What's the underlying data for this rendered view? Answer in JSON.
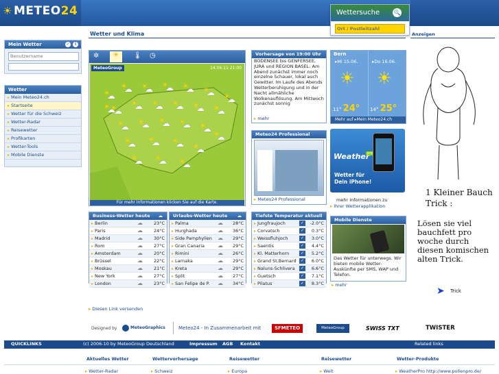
{
  "header": {
    "logo_text": "METEO",
    "logo_num": "24",
    "search_title": "Wettersuche",
    "search_placeholder": "Ort / Postleitzahl"
  },
  "main": {
    "title": "Wetter und Klima",
    "ads_label": "Anzeigen"
  },
  "left": {
    "mein_wetter": {
      "title": "Mein Wetter",
      "username_placeholder": "Benutzername"
    },
    "wetter": {
      "title": "Wetter",
      "items": [
        "Mein Meteo24.ch",
        "Startseite",
        "Wetter für die Schweiz",
        "Wetter-Radar",
        "Reisewetter",
        "Profikarten",
        "Wetter-Tools",
        "Mobile Dienste"
      ]
    }
  },
  "map": {
    "timestamp": "14.06.11 21:00",
    "brand": "MeteoGroup",
    "caption": "Für mehr Informationen klicken Sie auf die Karte."
  },
  "forecast": {
    "title": "Vorhersage von 19:00 Uhr",
    "text": "BODENSEE bis GENFERSEE, JURA und REGION BASEL: Am Abend zunächst immer noch einzelne Schauer, lokal auch Gewitter. Im Laufe des Abends Wetterberuhigung und in der Nacht allmähliche Wolkenauflösung. Am Mittwoch zunächst sonnig",
    "more": "mehr"
  },
  "bern": {
    "city": "Bern",
    "d1": "Mi 15.06.",
    "d2": "Do 16.06.",
    "min1": "11°",
    "max1": "24°",
    "min2": "14°",
    "max2": "25°",
    "link": "Mehr auf",
    "link2": "Mein Meteo24.ch"
  },
  "pro": {
    "title": "Meteo24 Professional",
    "link": "Meteo24 Professional"
  },
  "iphone": {
    "brand": "Weather",
    "badge": "pro",
    "text1": "Wetter für",
    "text2": "Dein iPhone!",
    "info1": "mehr Informationen zu",
    "info2": "Ihrer Wetterapplikation"
  },
  "business": {
    "title": "Business-Wetter heute",
    "rows": [
      [
        "Berlin",
        "23°C"
      ],
      [
        "Paris",
        "24°C"
      ],
      [
        "Madrid",
        "30°C"
      ],
      [
        "Rom",
        "27°C"
      ],
      [
        "Amsterdam",
        "20°C"
      ],
      [
        "Brüssel",
        "22°C"
      ],
      [
        "Moskau",
        "21°C"
      ],
      [
        "New York",
        "27°C"
      ],
      [
        "London",
        "23°C"
      ]
    ]
  },
  "urlaub": {
    "title": "Urlaubs-Wetter heute",
    "rows": [
      [
        "Palma",
        "28°C"
      ],
      [
        "Hurghada",
        "36°C"
      ],
      [
        "Side Pamphylien",
        "29°C"
      ],
      [
        "Gran Canaria",
        "29°C"
      ],
      [
        "Rimini",
        "26°C"
      ],
      [
        "Larnaka",
        "29°C"
      ],
      [
        "Kreta",
        "29°C"
      ],
      [
        "Split",
        "27°C"
      ],
      [
        "San Felipe de P.",
        "34°C"
      ]
    ]
  },
  "tiefste": {
    "title": "Tiefste Temperatur aktuell",
    "rows": [
      [
        "Jungfraujoch",
        "-2.0°C"
      ],
      [
        "Corvatsch",
        "0.3°C"
      ],
      [
        "Weissfluhjoch",
        "3.0°C"
      ],
      [
        "Saentis",
        "4.4°C"
      ],
      [
        "Kl. Matterhorn",
        "5.2°C"
      ],
      [
        "Grand St.Bernard",
        "6.0°C"
      ],
      [
        "Naluns-Schlivera",
        "6.6°C"
      ],
      [
        "Guetsch",
        "7.1°C"
      ],
      [
        "Pilatus",
        "8.3°C"
      ]
    ],
    "more": "mehr"
  },
  "mobile": {
    "title": "Mobile Dienste",
    "text": "Das Wetter für unterwegs. Wir bieten mobile Wetter-Auskünfte per SMS, WAP und Telefon."
  },
  "send_link": "Diesen Link versenden",
  "partners": {
    "designed_by": "Designed by",
    "meteographics": "MeteoGraphics",
    "coop": "Meteo24 - In Zusammenarbeit mit",
    "sfmeteo": "SFMETEO",
    "meteogroup": "MeteoGroup",
    "swisstxt": "SWISS TXT",
    "twister": "TWISTER"
  },
  "ad": {
    "line1": "1 Kleiner Bauch",
    "line2": "Trick :",
    "line3": "Lösen sie viel bauchfett pro woche durch diesen komischen alten Trick.",
    "cta": "Trick"
  },
  "footer": {
    "quicklinks": "QUICKLINKS",
    "copy": "(c) 2006-10 by MeteoGroup Deutschland",
    "impressum": "Impressum",
    "agb": "AGB",
    "kontakt": "Kontakt",
    "related": "Related links",
    "cols": [
      "Aktuelles Wetter",
      "Wettervorhersage",
      "Reisewetter",
      "Reisewetter",
      "Wetter-Produkte"
    ],
    "subs": [
      "Wetter-Radar",
      "Schweiz",
      "Europa",
      "Welt",
      "WeatherPro"
    ],
    "url": "http://www.pollenpro.de/"
  },
  "colors": {
    "brand_blue": "#1c4a8a",
    "accent_yellow": "#ffd400",
    "map_green": "#9ac93a"
  }
}
